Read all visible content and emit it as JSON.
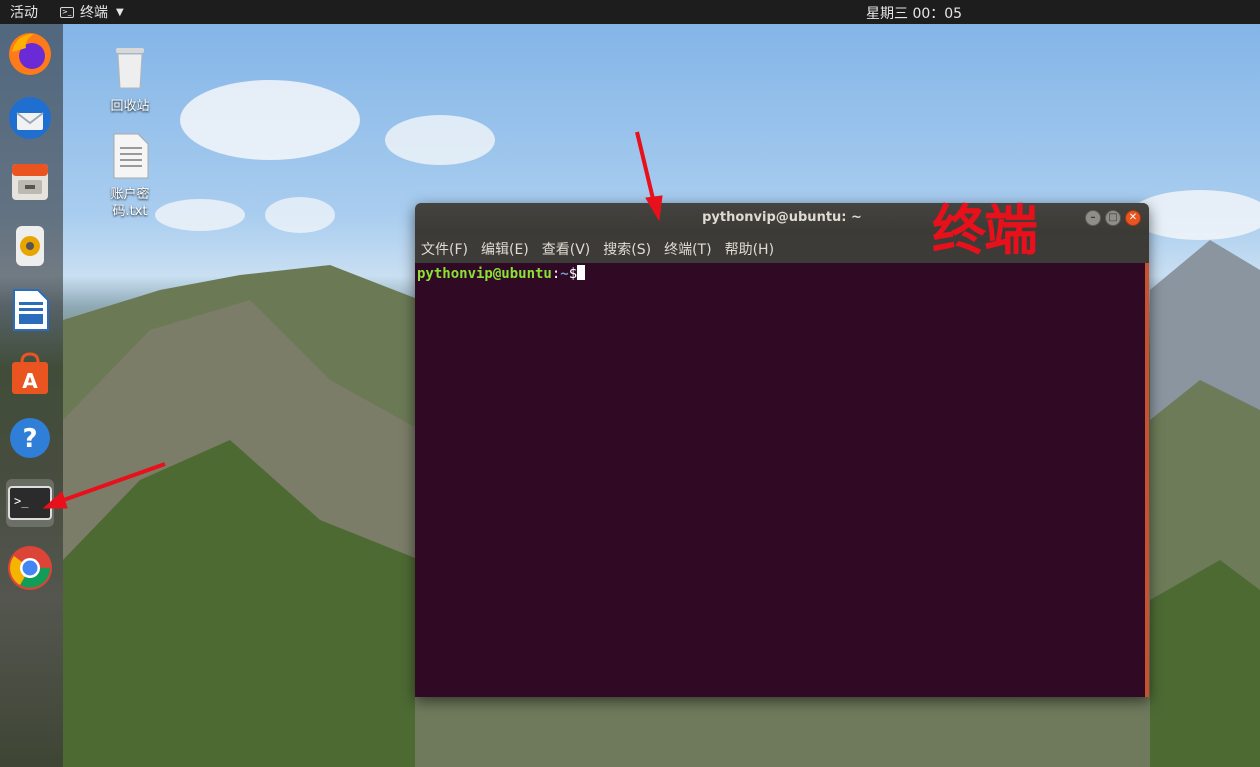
{
  "topbar": {
    "activities": "活动",
    "app_name": "终端",
    "clock": "星期三 00：05"
  },
  "dock": {
    "items": [
      {
        "name": "firefox"
      },
      {
        "name": "thunderbird"
      },
      {
        "name": "files"
      },
      {
        "name": "rhythmbox"
      },
      {
        "name": "libreoffice-writer"
      },
      {
        "name": "ubuntu-software"
      },
      {
        "name": "help"
      },
      {
        "name": "terminal",
        "active": true
      },
      {
        "name": "chrome"
      }
    ]
  },
  "desktop": {
    "icons": [
      {
        "label": "回收站",
        "icon": "trash-icon"
      },
      {
        "label": "账户密码.txt",
        "icon": "text-file-icon"
      }
    ]
  },
  "terminal": {
    "title": "pythonvip@ubuntu: ~",
    "menu": [
      "文件(F)",
      "编辑(E)",
      "查看(V)",
      "搜索(S)",
      "终端(T)",
      "帮助(H)"
    ],
    "prompt_user": "pythonvip@ubuntu",
    "prompt_sep": ":",
    "prompt_path": "~",
    "prompt_symbol": "$",
    "background": "#300a24"
  },
  "annotation": {
    "label": "终端",
    "color": "#e8101b"
  }
}
